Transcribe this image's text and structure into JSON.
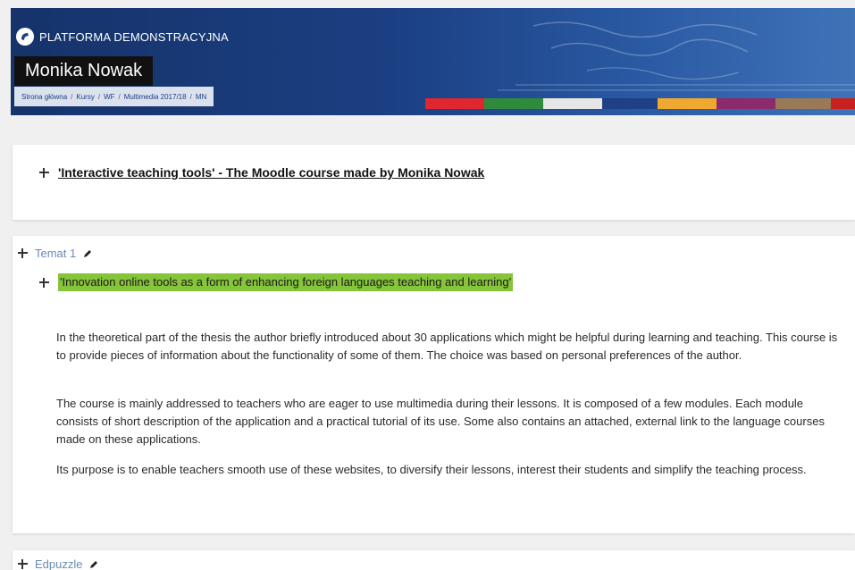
{
  "header": {
    "brand": "PLATFORMA DEMONSTRACYJNA",
    "user_name": "Monika Nowak",
    "breadcrumb": [
      "Strona główna",
      "Kursy",
      "WF",
      "Multimedia 2017/18",
      "MN"
    ],
    "color_bar": [
      "#e0262f",
      "#2f8a3c",
      "#e6e6e6",
      "#1f3f86",
      "#f0a830",
      "#8d2a6c",
      "#9a7a56",
      "#c8201e"
    ]
  },
  "course": {
    "title": "'Interactive teaching tools' - The Moodle course made by Monika Nowak"
  },
  "section1": {
    "title": "Temat 1",
    "highlight": "'Innovation online tools as a form of enhancing foreign languages teaching and learning'",
    "paragraphs": [
      "In the theoretical part of the thesis the author briefly introduced about 30 applications which might be helpful during learning and teaching. This course is to provide pieces of information about the functionality of some of them. The choice was based on personal preferences of the author.",
      "The course is mainly addressed to teachers who are eager to use multimedia during their lessons. It is composed of a few modules. Each module consists of short description of the application and a practical tutorial of its use. Some also contains an attached, external link to the language courses made on these applications.",
      "Its purpose is to enable teachers smooth use of these websites, to diversify their lessons, interest their students and simplify the teaching process."
    ]
  },
  "section2": {
    "title": "Edpuzzle"
  }
}
